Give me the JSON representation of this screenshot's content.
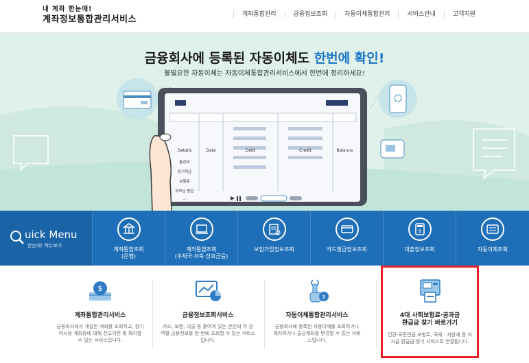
{
  "header": {
    "logo_tagline": "내 계좌 한눈에!",
    "logo_name": "계좌정보통합관리서비스",
    "nav": [
      "계좌통합관리",
      "금융정보조회",
      "자동이체통합관리",
      "서비스안내",
      "고객지원"
    ]
  },
  "hero": {
    "title_prefix": "금융회사에 등록된 자동이체도 ",
    "title_highlight": "한번에 확인!",
    "subtitle": "불필요한 자동이체는 자동이체통합관리서비스에서 한번에 정리하세요!",
    "table_headers": [
      "Details",
      "Date",
      "Debt",
      "Credit",
      "Balance"
    ],
    "table_rows": [
      "통신비",
      "정기적금",
      "보험료",
      "부모님 용돈",
      "..."
    ]
  },
  "quick_menu": {
    "title": "uick Menu",
    "subtitle": "한눈에! 메뉴보기",
    "items": [
      {
        "label": "계좌통합조회",
        "sub": "(은행)",
        "icon": "bank-icon"
      },
      {
        "label": "계좌통합조회",
        "sub": "(우체국·저축·상호금융)",
        "icon": "laptop-icon"
      },
      {
        "label": "보험가입정보조회",
        "sub": "",
        "icon": "insurance-doc-icon"
      },
      {
        "label": "카드발급정보조회",
        "sub": "",
        "icon": "card-icon"
      },
      {
        "label": "대출정보조회",
        "sub": "",
        "icon": "calculator-icon"
      },
      {
        "label": "자동이체조회",
        "sub": "",
        "icon": "auto-transfer-icon"
      }
    ]
  },
  "services": [
    {
      "title": "계좌통합관리서비스",
      "desc": "금융회사에서 개설한 계좌를 조회하고, 장기 미사용 계좌등에 대해 잔고이전 및 해지할 수 있는 서비스입니다.",
      "icon": "money-bag-icon"
    },
    {
      "title": "금융정보조회서비스",
      "desc": "카드, 보험, 대출 등 흩어져 있는 본인의 각 권역별 금융정보를 한 번에 조회할 수 있는 서비스입니다.",
      "icon": "chart-monitor-icon"
    },
    {
      "title": "자동이체통합관리서비스",
      "desc": "금융회사에 등록된 자동이체를 조회하거나 해지하거나 출금계좌를 변경할 수 있는 서비스입니다.",
      "icon": "touch-coin-icon"
    },
    {
      "title_line1": "4대 사회보험료·공과금",
      "title_line2": "환급금 찾기 바로가기",
      "desc": "건강·국민연금 보험료, 국세 · 지방세 등 미지급 환급금 찾기 서비스로 연결됩니다.",
      "icon": "atm-icon"
    }
  ],
  "colors": {
    "accent": "#1f6fb8",
    "hero_bg": "#dff1ea",
    "highlight": "#e8202a",
    "title_blue": "#1a74c6"
  }
}
